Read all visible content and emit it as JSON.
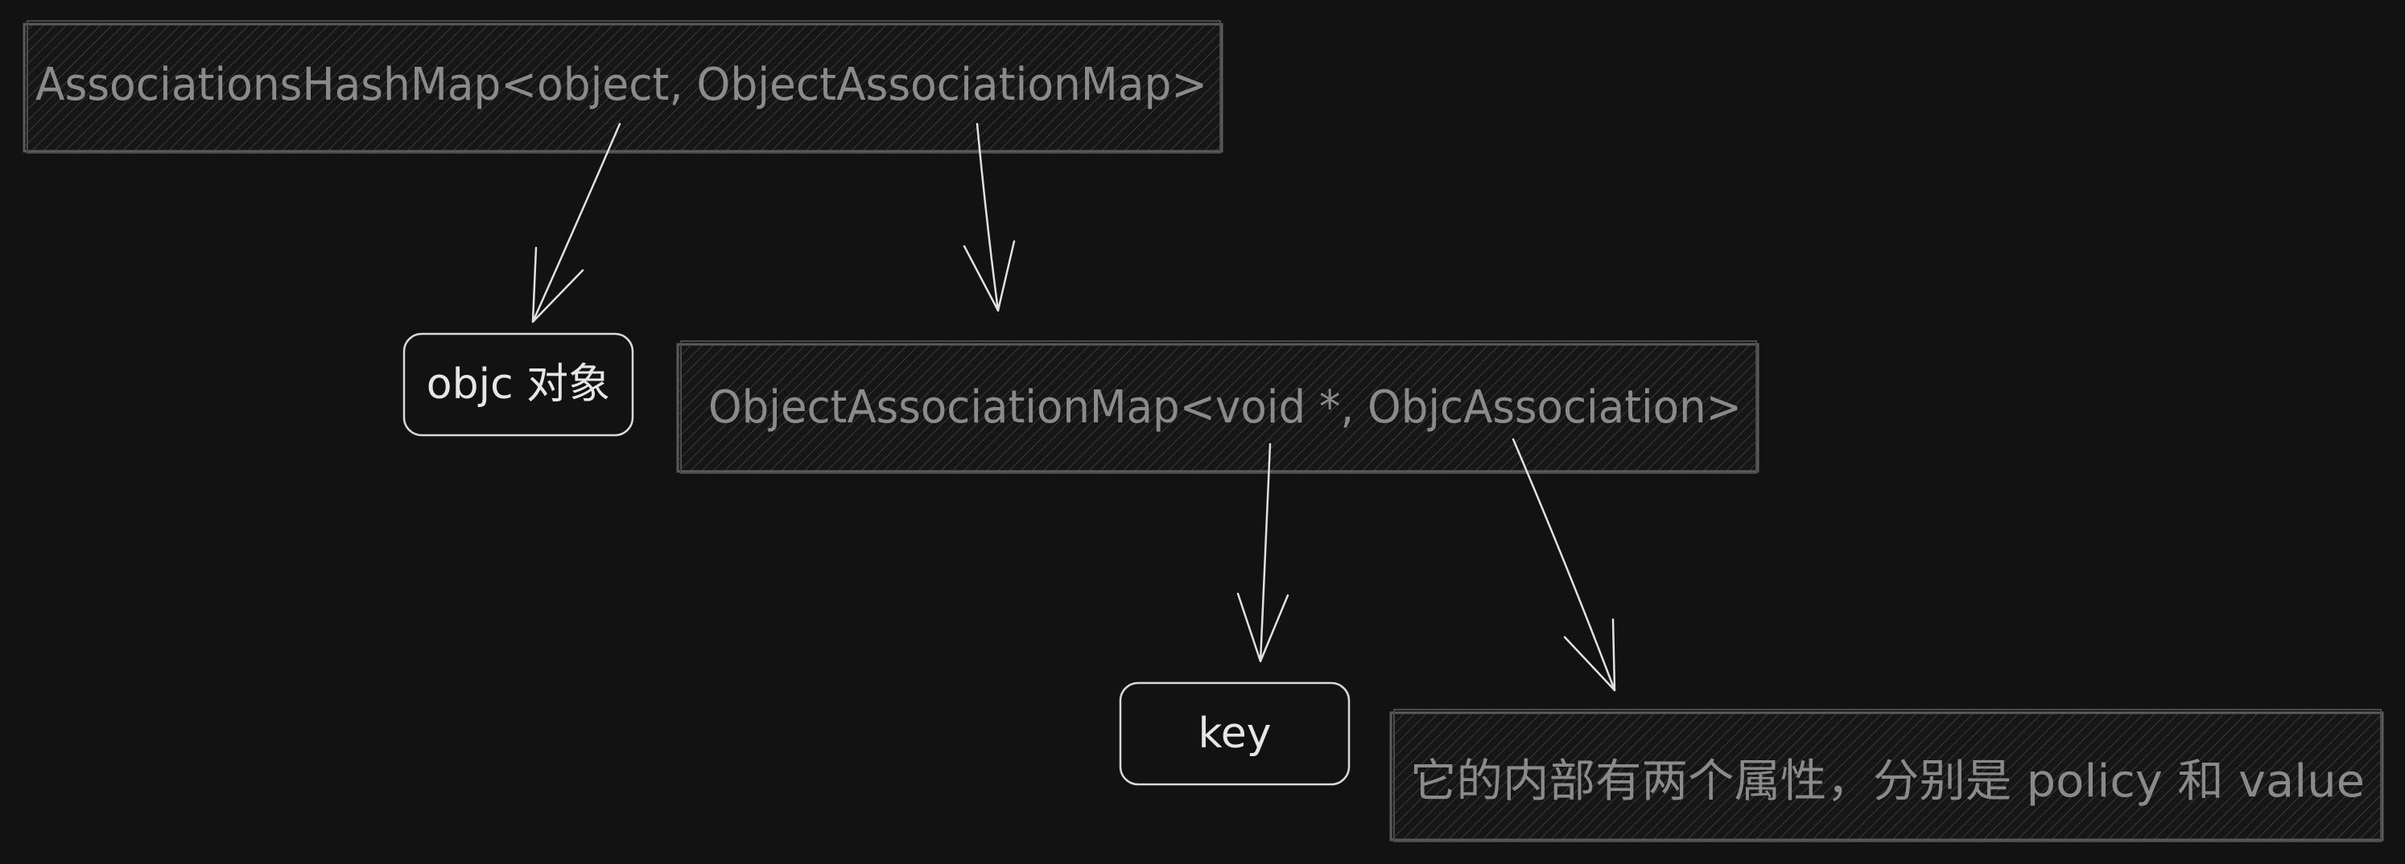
{
  "nodes": {
    "associations_hash_map": "AssociationsHashMap<object, ObjectAssociationMap>",
    "objc_object": "objc 对象",
    "object_association_map": "ObjectAssociationMap<void *, ObjcAssociation>",
    "key": "key",
    "value_desc": "它的内部有两个属性，分别是 policy 和 value"
  },
  "colors": {
    "background": "#121212",
    "hatched_text": "#8a8a8a",
    "outline_text": "#e6e6e6",
    "arrow": "#e0e0e0"
  }
}
